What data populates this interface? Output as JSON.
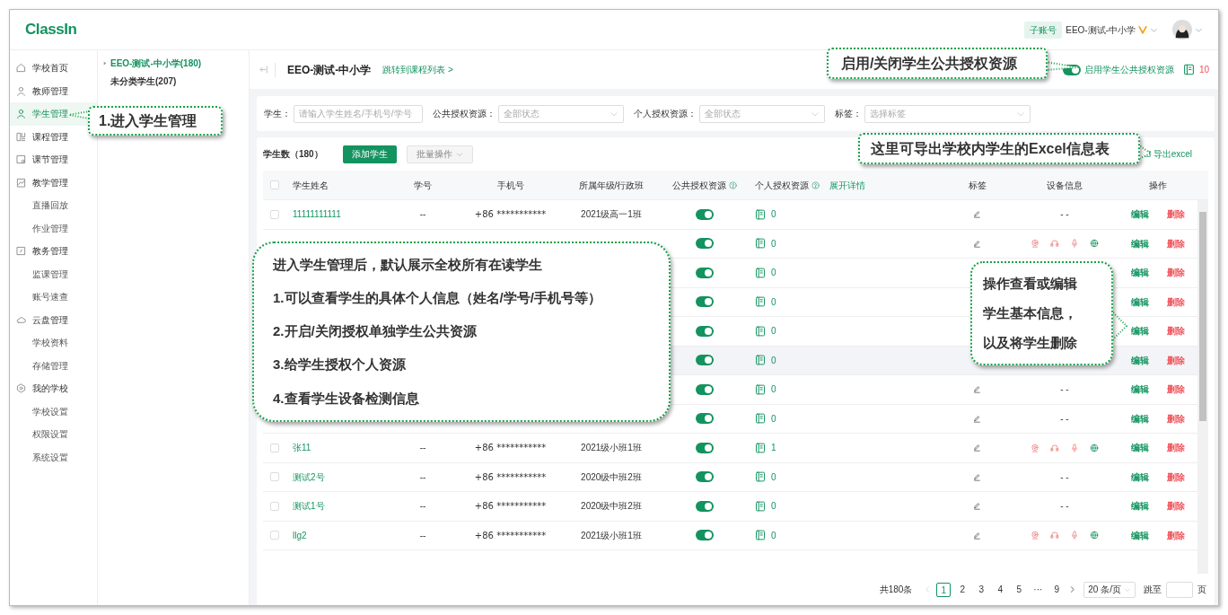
{
  "logo": "ClassIn",
  "account": {
    "badge": "子账号",
    "school": "EEO-测试-中小学"
  },
  "sidebar": {
    "items": [
      {
        "label": "学校首页",
        "selected": false
      },
      {
        "label": "教师管理",
        "selected": false
      },
      {
        "label": "学生管理",
        "selected": true
      },
      {
        "label": "课程管理",
        "selected": false
      },
      {
        "label": "课节管理",
        "selected": false
      },
      {
        "label": "教学管理",
        "selected": false,
        "children": [
          {
            "label": "直播回放",
            "selected": false
          },
          {
            "label": "作业管理",
            "selected": false
          }
        ]
      },
      {
        "label": "教务管理",
        "selected": false,
        "children": [
          {
            "label": "监课管理",
            "selected": false
          },
          {
            "label": "账号速查",
            "selected": false
          }
        ]
      },
      {
        "label": "云盘管理",
        "selected": false,
        "children": [
          {
            "label": "学校资料",
            "selected": false
          },
          {
            "label": "存储管理",
            "selected": false
          }
        ]
      },
      {
        "label": "我的学校",
        "selected": false,
        "children": [
          {
            "label": "学校设置",
            "selected": false
          },
          {
            "label": "权限设置",
            "selected": false
          },
          {
            "label": "系统设置",
            "selected": false
          }
        ]
      }
    ]
  },
  "tree": [
    {
      "label": "EEO-测试-中小学(180)",
      "selected": true,
      "expandable": true
    },
    {
      "label": "未分类学生(207)",
      "selected": false,
      "expandable": false
    }
  ],
  "header": {
    "title": "EEO-测试-中小学",
    "link": "跳转到课程列表 >",
    "public_toggle": {
      "on": true,
      "label": "启用学生公共授权资源"
    },
    "resource_count": "10"
  },
  "filters": [
    {
      "kind": "input",
      "label": "学生：",
      "placeholder": "请输入学生姓名/手机号/学号"
    },
    {
      "kind": "select",
      "label": "公共授权资源：",
      "placeholder": "全部状态"
    },
    {
      "kind": "select",
      "label": "个人授权资源：",
      "placeholder": "全部状态"
    },
    {
      "kind": "select",
      "label": "标签：",
      "placeholder": "选择标签"
    }
  ],
  "table": {
    "count_label": "学生数（180）",
    "add_button": "添加学生",
    "batch_button": {
      "label": "批量操作",
      "disabled": true
    },
    "export": "导出excel",
    "select_all_checked": false,
    "expand_link": "展开详情",
    "columns": [
      {
        "label": "学生姓名",
        "help": false
      },
      {
        "label": "学号",
        "help": false
      },
      {
        "label": "手机号",
        "help": false
      },
      {
        "label": "所属年级/行政班",
        "help": false
      },
      {
        "label": "公共授权资源",
        "help": true
      },
      {
        "label": "个人授权资源",
        "help": true
      },
      {
        "label": "标签",
        "help": false
      },
      {
        "label": "设备信息",
        "help": false
      },
      {
        "label": "操作",
        "help": false
      }
    ],
    "rows": [
      {
        "checked": false,
        "name": "11111111111",
        "id": "--",
        "phone": "+86 ***********",
        "class": "2021级高一1班",
        "public_on": true,
        "personal": "0",
        "tag_editable": true,
        "device": {
          "kind": "dash",
          "text": "- -"
        },
        "actions": [
          "编辑",
          "删除"
        ],
        "highlighted": false
      },
      {
        "public_on": true,
        "personal": "0",
        "tag_editable": true,
        "device": {
          "kind": "icons"
        },
        "actions": [
          "编辑",
          "删除"
        ],
        "highlighted": false
      },
      {
        "public_on": true,
        "personal": "0",
        "actions": [
          "编辑",
          "删除"
        ],
        "highlighted": false
      },
      {
        "public_on": true,
        "personal": "0",
        "actions": [
          "编辑",
          "删除"
        ],
        "highlighted": false
      },
      {
        "public_on": true,
        "personal": "0",
        "actions": [
          "编辑",
          "删除"
        ],
        "highlighted": false
      },
      {
        "public_on": true,
        "personal": "0",
        "actions": [
          "编辑",
          "删除"
        ],
        "highlighted": true
      },
      {
        "public_on": true,
        "personal": "0",
        "tag_editable": true,
        "device": {
          "kind": "dash",
          "text": "- -"
        },
        "actions": [
          "编辑",
          "删除"
        ],
        "highlighted": false
      },
      {
        "public_on": true,
        "personal": "0",
        "tag_editable": true,
        "device": {
          "kind": "dash",
          "text": "- -"
        },
        "actions": [
          "编辑",
          "删除"
        ],
        "highlighted": false
      },
      {
        "checked": false,
        "name": "张11",
        "id": "--",
        "phone": "+86 ***********",
        "class": "2021级小班1班",
        "public_on": true,
        "personal": "1",
        "tag_editable": true,
        "device": {
          "kind": "icons"
        },
        "actions": [
          "编辑",
          "删除"
        ],
        "highlighted": false
      },
      {
        "checked": false,
        "name": "测试2号",
        "id": "--",
        "phone": "+86 ***********",
        "class": "2020级中班2班",
        "public_on": true,
        "personal": "0",
        "tag_editable": true,
        "device": {
          "kind": "dash",
          "text": "- -"
        },
        "actions": [
          "编辑",
          "删除"
        ],
        "highlighted": false
      },
      {
        "checked": false,
        "name": "测试1号",
        "id": "--",
        "phone": "+86 ***********",
        "class": "2020级中班2班",
        "public_on": true,
        "personal": "0",
        "tag_editable": true,
        "device": {
          "kind": "dash",
          "text": "- -"
        },
        "actions": [
          "编辑",
          "删除"
        ],
        "highlighted": false
      },
      {
        "checked": false,
        "name": "llg2",
        "id": "--",
        "phone": "+86 ***********",
        "class": "2021级小班1班",
        "public_on": true,
        "personal": "0",
        "tag_editable": true,
        "device": {
          "kind": "icons"
        },
        "actions": [
          "编辑",
          "删除"
        ],
        "highlighted": false
      }
    ]
  },
  "pagination": {
    "total": "共180条",
    "pages": [
      {
        "label": "1",
        "selected": true
      },
      {
        "label": "2",
        "selected": false
      },
      {
        "label": "3",
        "selected": false
      },
      {
        "label": "4",
        "selected": false
      },
      {
        "label": "5",
        "selected": false
      },
      {
        "label": "···",
        "selected": false
      },
      {
        "label": "9",
        "selected": false
      }
    ],
    "per_page": "20 条/页",
    "jump": "跳至",
    "page_unit": "页"
  },
  "callouts": [
    {
      "lines": [
        "1.进入学生管理"
      ]
    },
    {
      "lines": [
        "启用/关闭学生公共授权资源"
      ]
    },
    {
      "lines": [
        "这里可导出学校内学生的Excel信息表"
      ]
    },
    {
      "lines": [
        "进入学生管理后，默认展示全校所有在读学生",
        "1.可以查看学生的具体个人信息（姓名/学号/手机号等）",
        "2.开启/关闭授权单独学生公共资源",
        "3.给学生授权个人资源",
        "4.查看学生设备检测信息"
      ]
    },
    {
      "lines": [
        "操作查看或编辑",
        "学生基本信息，",
        "以及将学生删除"
      ]
    }
  ]
}
